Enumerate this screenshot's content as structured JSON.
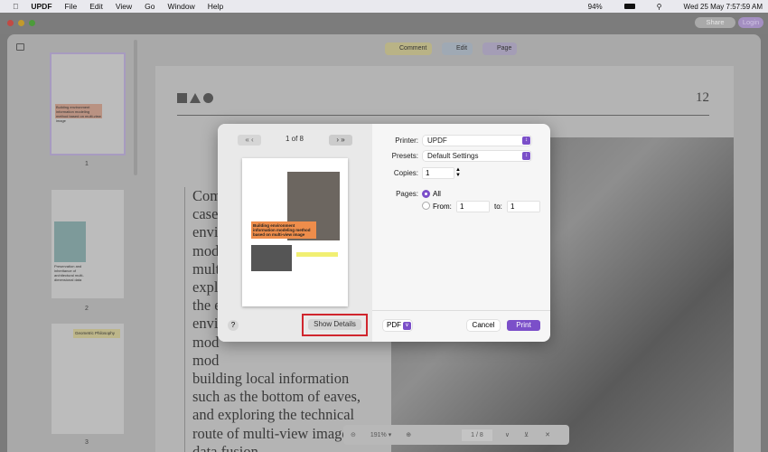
{
  "menubar": {
    "app": "UPDF",
    "items": [
      "File",
      "Edit",
      "View",
      "Go",
      "Window",
      "Help"
    ],
    "battery": "94%",
    "datetime": "Wed 25 May  7:57:59 AM"
  },
  "window": {
    "share": "Share",
    "login": "Login"
  },
  "toolbar": {
    "comment": "Comment",
    "edit": "Edit",
    "page": "Page"
  },
  "thumbnails": [
    {
      "num": "1",
      "caption": "Building environment information modeling method based on multi-view image"
    },
    {
      "num": "2",
      "caption": "Preservation and inheritance of architectural multi-dimensional data"
    },
    {
      "num": "3",
      "caption": "Geometric Philosophy"
    }
  ],
  "document": {
    "page_number": "12",
    "lines": [
      "Com",
      "case",
      "envi",
      "mod",
      "mult",
      "expl",
      "the e",
      "envi",
      "mod",
      "mod",
      "building local information",
      "such as the bottom of eaves,",
      "and exploring the technical",
      "route of multi-view image",
      "data fusion."
    ]
  },
  "bottombar": {
    "zoom": "191%",
    "current_page": "1",
    "total_pages": "8"
  },
  "dialog": {
    "page_indicator": "1 of 8",
    "preview_title": "Building environment information modeling method based on multi-view image",
    "printer_label": "Printer:",
    "printer": "UPDF",
    "presets_label": "Presets:",
    "presets": "Default Settings",
    "copies_label": "Copies:",
    "copies": "1",
    "pages_label": "Pages:",
    "all": "All",
    "from_label": "From:",
    "from": "1",
    "to_label": "to:",
    "to": "1",
    "help": "?",
    "show_details": "Show Details",
    "pdf": "PDF",
    "cancel": "Cancel",
    "print": "Print"
  },
  "colors": {
    "accent": "#7b4fc9",
    "highlight": "#d0262e"
  }
}
